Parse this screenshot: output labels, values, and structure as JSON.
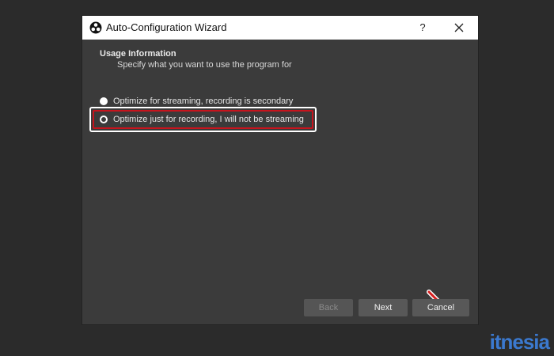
{
  "window": {
    "title": "Auto-Configuration Wizard",
    "help_label": "?",
    "icon": "obs-logo-icon"
  },
  "section": {
    "title": "Usage Information",
    "subtitle": "Specify what you want to use the program for"
  },
  "options": [
    {
      "label": "Optimize for streaming, recording is secondary",
      "selected": true
    },
    {
      "label": "Optimize just for recording, I will not be streaming",
      "selected": false,
      "highlighted": true
    }
  ],
  "buttons": {
    "back": "Back",
    "next": "Next",
    "cancel": "Cancel"
  },
  "colors": {
    "dialog_bg": "#3b3b3b",
    "highlight": "#c6141d",
    "arrow": "#d62020",
    "watermark": "#3c7ed8"
  },
  "watermark": "itnesia"
}
